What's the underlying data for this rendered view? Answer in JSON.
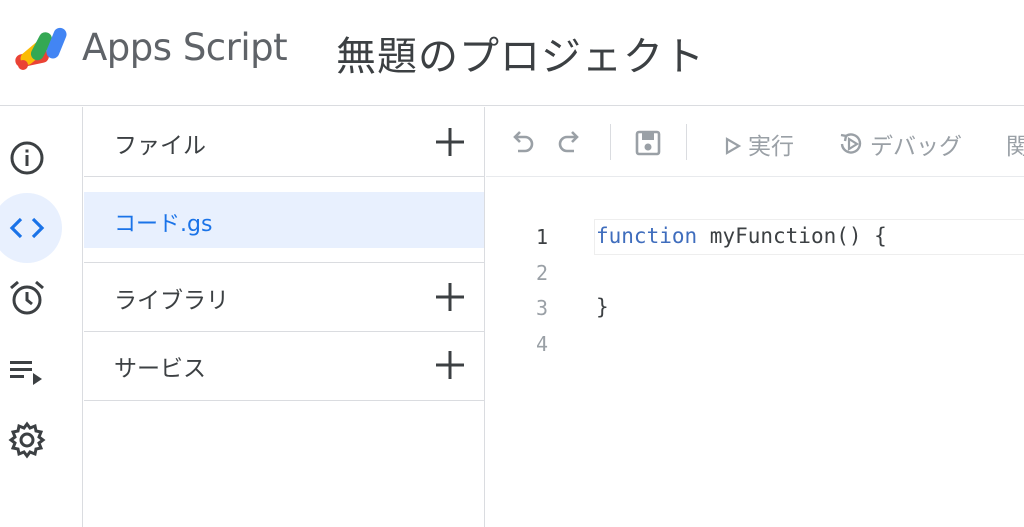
{
  "header": {
    "app_name": "Apps Script",
    "project_title": "無題のプロジェクト"
  },
  "leftnav": {
    "items": [
      {
        "name": "overview",
        "icon": "info-icon"
      },
      {
        "name": "editor",
        "icon": "code-icon",
        "active": true
      },
      {
        "name": "triggers",
        "icon": "alarm-icon"
      },
      {
        "name": "executions",
        "icon": "playlist-icon"
      },
      {
        "name": "settings",
        "icon": "gear-icon"
      }
    ]
  },
  "files_panel": {
    "files_label": "ファイル",
    "file_name": "コード.gs",
    "libraries_label": "ライブラリ",
    "services_label": "サービス"
  },
  "toolbar": {
    "run_label": "実行",
    "debug_label": "デバッグ",
    "function_label_partial": "関"
  },
  "editor": {
    "line_numbers": [
      "1",
      "2",
      "3",
      "4"
    ],
    "line1_keyword": "function",
    "line1_rest": " myFunction() {",
    "line3": "}"
  },
  "colors": {
    "accent": "#1a73e8",
    "active_bg": "#e8f0fe",
    "keyword": "#3f6dbd",
    "border": "#dadce0"
  }
}
